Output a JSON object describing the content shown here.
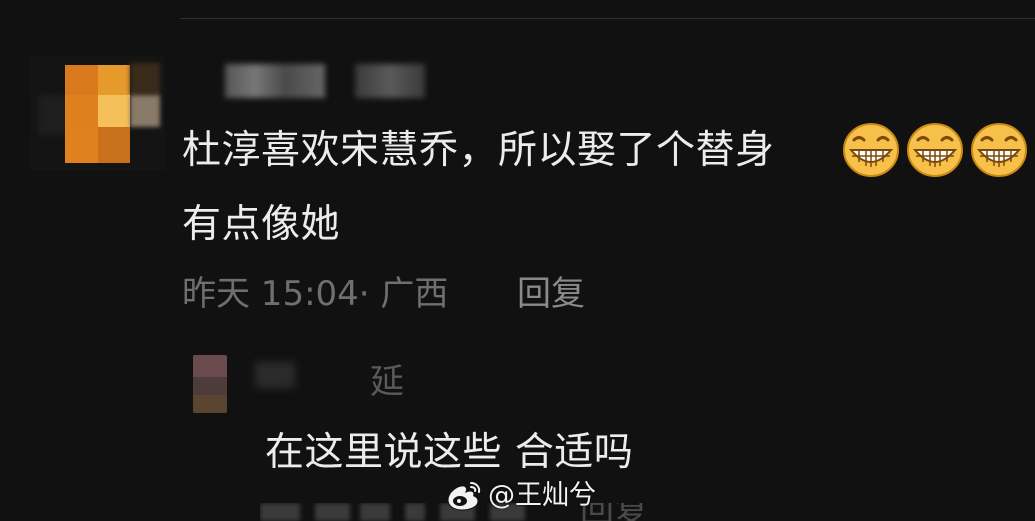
{
  "comment": {
    "line1": "杜淳喜欢宋慧乔，所以娶了个替身",
    "line2": "有点像她",
    "emoji_icon": "grinning-face-icon",
    "emoji_count": 3,
    "meta": "昨天 15:04· 广西",
    "reply_label": "回复"
  },
  "reply": {
    "name_visible_char": "延",
    "text": "在这里说这些 合适吗",
    "reply_label_cut": "回复"
  },
  "watermark": {
    "logo_icon": "weibo-logo-icon",
    "text": "@王灿兮"
  },
  "colors": {
    "background": "#111111",
    "text_primary": "#ececec",
    "text_meta": "#6f6f6f",
    "emoji_face": "#f6c04a"
  }
}
